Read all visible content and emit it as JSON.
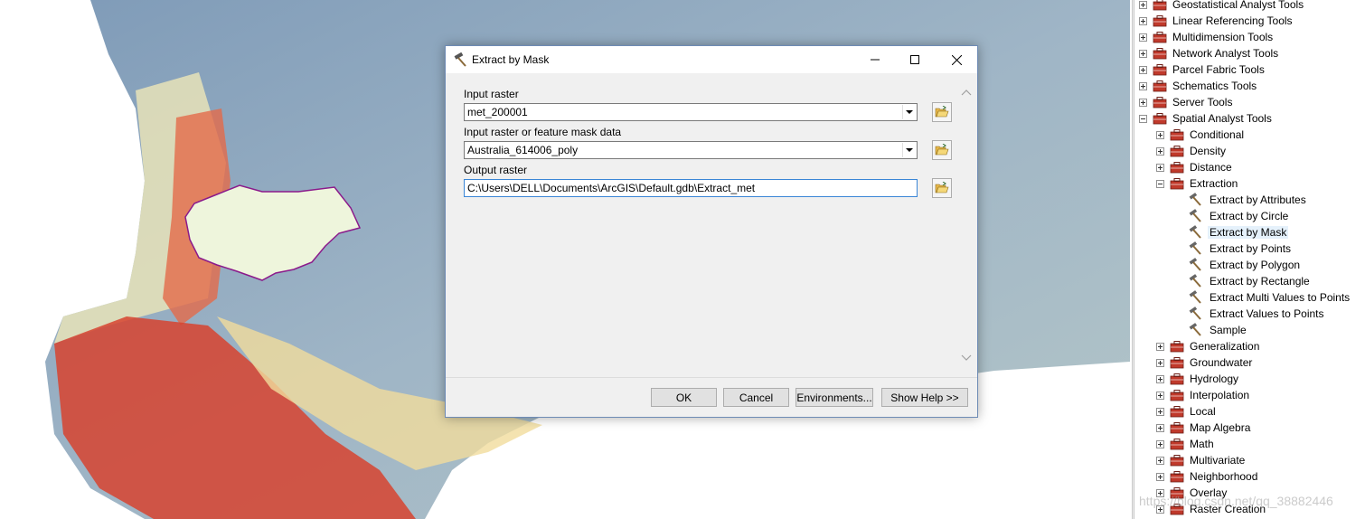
{
  "dialog": {
    "title": "Extract by Mask",
    "title_icon": "hammer-icon",
    "fields": [
      {
        "label": "Input raster",
        "value": "met_200001",
        "type": "combo"
      },
      {
        "label": "Input raster or feature mask data",
        "value": "Australia_614006_poly",
        "type": "combo"
      },
      {
        "label": "Output raster",
        "value": "C:\\Users\\DELL\\Documents\\ArcGIS\\Default.gdb\\Extract_met",
        "type": "text"
      }
    ],
    "buttons": {
      "ok": "OK",
      "cancel": "Cancel",
      "environments": "Environments...",
      "help": "Show Help >>"
    }
  },
  "tree": {
    "toolboxes_above": [
      {
        "label": "Geostatistical Analyst Tools",
        "expanded": false
      },
      {
        "label": "Linear Referencing Tools",
        "expanded": false
      },
      {
        "label": "Multidimension Tools",
        "expanded": false
      },
      {
        "label": "Network Analyst Tools",
        "expanded": false
      },
      {
        "label": "Parcel Fabric Tools",
        "expanded": false
      },
      {
        "label": "Schematics Tools",
        "expanded": false
      },
      {
        "label": "Server Tools",
        "expanded": false
      },
      {
        "label": "Spatial Analyst Tools",
        "expanded": true
      }
    ],
    "toolsets_before": [
      {
        "label": "Conditional",
        "expanded": false
      },
      {
        "label": "Density",
        "expanded": false
      },
      {
        "label": "Distance",
        "expanded": false
      },
      {
        "label": "Extraction",
        "expanded": true
      }
    ],
    "extraction_tools": [
      {
        "label": "Extract by Attributes",
        "selected": false
      },
      {
        "label": "Extract by Circle",
        "selected": false
      },
      {
        "label": "Extract by Mask",
        "selected": true
      },
      {
        "label": "Extract by Points",
        "selected": false
      },
      {
        "label": "Extract by Polygon",
        "selected": false
      },
      {
        "label": "Extract by Rectangle",
        "selected": false
      },
      {
        "label": "Extract Multi Values to Points",
        "selected": false
      },
      {
        "label": "Extract Values to Points",
        "selected": false
      },
      {
        "label": "Sample",
        "selected": false
      }
    ],
    "toolsets_after": [
      {
        "label": "Generalization",
        "expanded": false
      },
      {
        "label": "Groundwater",
        "expanded": false
      },
      {
        "label": "Hydrology",
        "expanded": false
      },
      {
        "label": "Interpolation",
        "expanded": false
      },
      {
        "label": "Local",
        "expanded": false
      },
      {
        "label": "Map Algebra",
        "expanded": false
      },
      {
        "label": "Math",
        "expanded": false
      },
      {
        "label": "Multivariate",
        "expanded": false
      },
      {
        "label": "Neighborhood",
        "expanded": false
      },
      {
        "label": "Overlay",
        "expanded": false
      },
      {
        "label": "Raster Creation",
        "expanded": false
      }
    ]
  },
  "watermark": "https://blog.csdn.net/qq_38882446",
  "colors": {
    "sea": "#8fa7bf",
    "raster_low": "#b9c8c4",
    "raster_mid": "#f3e9b0",
    "raster_high": "#d9322a",
    "mask_polygon_fill": "#eef5dc",
    "mask_polygon_stroke": "#8b1a8b",
    "selection": "#e5f1fb"
  }
}
